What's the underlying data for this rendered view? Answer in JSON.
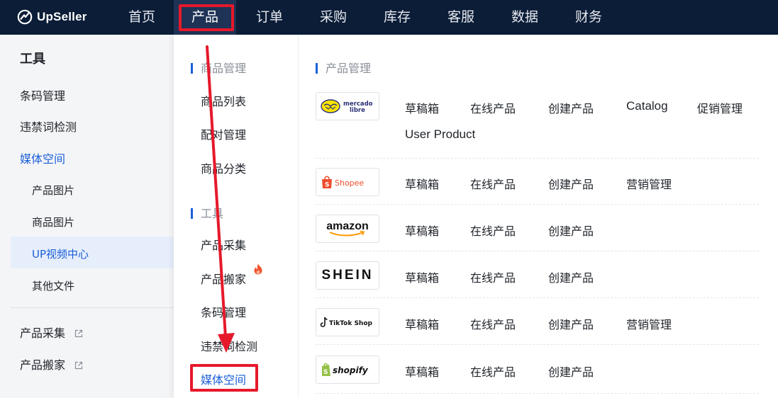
{
  "brand": {
    "name": "UpSeller"
  },
  "topnav": {
    "items": [
      "首页",
      "产品",
      "订单",
      "采购",
      "库存",
      "客服",
      "数据",
      "财务"
    ],
    "active_index": 1
  },
  "sidebar": {
    "title": "工具",
    "items": [
      {
        "label": "条码管理"
      },
      {
        "label": "违禁词检测"
      },
      {
        "label": "媒体空间",
        "active": true
      },
      {
        "label": "产品图片",
        "sub": true
      },
      {
        "label": "商品图片",
        "sub": true
      },
      {
        "label": "UP视频中心",
        "sub": true,
        "selected": true
      },
      {
        "label": "其他文件",
        "sub": true
      },
      {
        "label": "产品采集",
        "external": true
      },
      {
        "label": "产品搬家",
        "external": true
      }
    ]
  },
  "dropdown": {
    "sections": [
      {
        "title": "商品管理",
        "items": [
          "商品列表",
          "配对管理",
          "商品分类"
        ]
      },
      {
        "title": "工具",
        "items": [
          "产品采集",
          "产品搬家",
          "条码管理",
          "违禁词检测",
          "媒体空间"
        ]
      }
    ],
    "hot_item": "产品搬家",
    "highlighted_item": "媒体空间"
  },
  "product_management": {
    "title": "产品管理",
    "platforms": [
      {
        "name": "mercado-libre",
        "logo_text": [
          "mercado",
          "libre"
        ],
        "links": [
          "草稿箱",
          "在线产品",
          "创建产品",
          "Catalog",
          "促销管理",
          "User Product"
        ]
      },
      {
        "name": "shopee",
        "logo_text": "Shopee",
        "links": [
          "草稿箱",
          "在线产品",
          "创建产品",
          "营销管理"
        ]
      },
      {
        "name": "amazon",
        "logo_text": "amazon",
        "links": [
          "草稿箱",
          "在线产品",
          "创建产品"
        ]
      },
      {
        "name": "shein",
        "logo_text": "SHEIN",
        "links": [
          "草稿箱",
          "在线产品",
          "创建产品"
        ]
      },
      {
        "name": "tiktok-shop",
        "logo_text": "TikTok Shop",
        "links": [
          "草稿箱",
          "在线产品",
          "创建产品",
          "营销管理"
        ]
      },
      {
        "name": "shopify",
        "logo_text": "shopify",
        "links": [
          "草稿箱",
          "在线产品",
          "创建产品"
        ]
      }
    ]
  },
  "colors": {
    "nav_bg": "#0b1d37",
    "accent": "#1a5fd8",
    "annotation_red": "#e6192b",
    "shopee": "#ee4d2d",
    "shopify": "#95bf47",
    "mercado": "#ffe600"
  }
}
